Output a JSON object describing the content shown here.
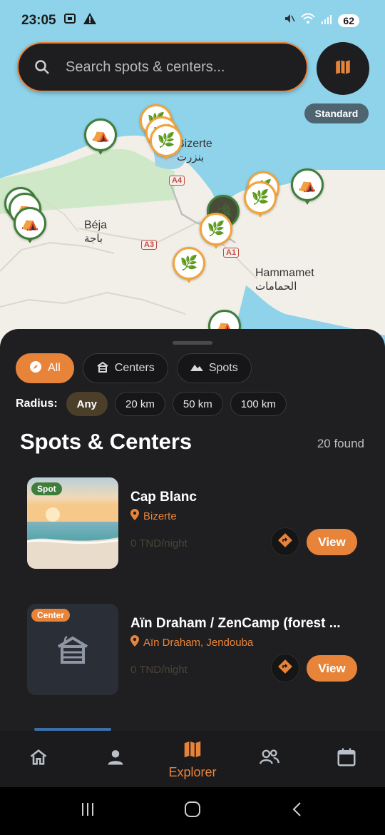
{
  "status_bar": {
    "time": "23:05",
    "battery": "62"
  },
  "search": {
    "placeholder": "Search spots & centers..."
  },
  "map": {
    "style_label": "Standard",
    "places": [
      {
        "name": "Bizerte",
        "arabic": "بنزرت"
      },
      {
        "name": "Béja",
        "arabic": "باجة"
      },
      {
        "name": "Hammamet",
        "arabic": "الحمامات"
      }
    ],
    "roads": [
      "A4",
      "A3",
      "A1"
    ]
  },
  "filters": {
    "items": [
      {
        "label": "All",
        "icon": "compass-icon",
        "active": true
      },
      {
        "label": "Centers",
        "icon": "building-icon",
        "active": false
      },
      {
        "label": "Spots",
        "icon": "mountain-icon",
        "active": false
      }
    ]
  },
  "radius": {
    "label": "Radius:",
    "options": [
      {
        "label": "Any",
        "active": true
      },
      {
        "label": "20 km",
        "active": false
      },
      {
        "label": "50 km",
        "active": false
      },
      {
        "label": "100 km",
        "active": false
      }
    ]
  },
  "list": {
    "title": "Spots & Centers",
    "count": "20 found",
    "items": [
      {
        "badge": "Spot",
        "title": "Cap Blanc",
        "location": "Bizerte",
        "price": "0 TND/night",
        "view_label": "View"
      },
      {
        "badge": "Center",
        "title": "Aïn Draham / ZenCamp (forest ...",
        "location": "Aïn Draham, Jendouba",
        "price": "0 TND/night",
        "view_label": "View"
      }
    ]
  },
  "bottom_nav": {
    "items": [
      {
        "icon": "home-icon",
        "label": ""
      },
      {
        "icon": "person-icon",
        "label": ""
      },
      {
        "icon": "map-icon",
        "label": "Explorer",
        "active": true
      },
      {
        "icon": "group-icon",
        "label": ""
      },
      {
        "icon": "calendar-icon",
        "label": ""
      }
    ]
  },
  "colors": {
    "accent": "#e8843a",
    "background": "#1f1f21",
    "spot_badge": "#3f7d3a",
    "center_badge": "#e8843a"
  }
}
